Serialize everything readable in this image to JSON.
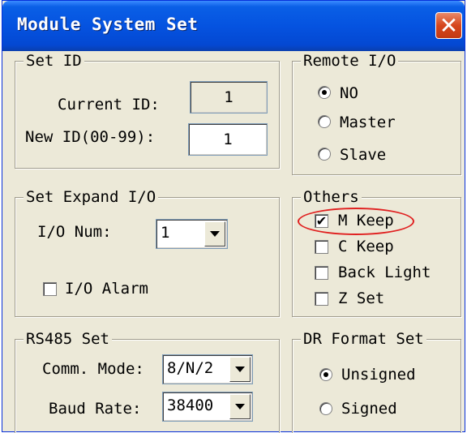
{
  "window": {
    "title": "Module System Set",
    "close_icon": "close-icon",
    "close_color": "#d6461c",
    "titlebar_color": "#0553e0"
  },
  "set_id": {
    "legend": "Set ID",
    "current_label": "Current ID:",
    "current_value": "1",
    "new_label": "New ID(00-99):",
    "new_value": "1"
  },
  "remote_io": {
    "legend": "Remote I/O",
    "options": [
      "NO",
      "Master",
      "Slave"
    ],
    "selected": "NO"
  },
  "expand_io": {
    "legend": "Set Expand I/O",
    "num_label": "I/O Num:",
    "num_value": "1",
    "alarm_label": "I/O Alarm",
    "alarm_checked": false
  },
  "others": {
    "legend": "Others",
    "items": [
      {
        "label": "M Keep",
        "checked": true
      },
      {
        "label": "C Keep",
        "checked": false
      },
      {
        "label": "Back Light",
        "checked": false
      },
      {
        "label": "Z Set",
        "checked": false
      }
    ],
    "highlight_color": "#e02020"
  },
  "rs485": {
    "legend": "RS485 Set",
    "mode_label": "Comm. Mode:",
    "mode_value": "8/N/2",
    "baud_label": "Baud Rate:",
    "baud_value": "38400"
  },
  "dr_format": {
    "legend": "DR Format Set",
    "options": [
      "Unsigned",
      "Signed"
    ],
    "selected": "Unsigned"
  }
}
